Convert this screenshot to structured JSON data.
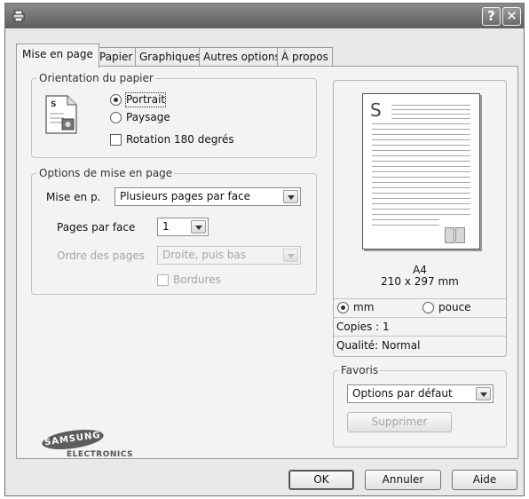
{
  "titlebar": {
    "title": "",
    "help_label": "?",
    "close_label": "✕",
    "app_icon": "printer-icon"
  },
  "tabs": [
    {
      "label": "Mise en page",
      "active": true
    },
    {
      "label": "Papier"
    },
    {
      "label": "Graphiques"
    },
    {
      "label": "Autres options"
    },
    {
      "label": "À propos"
    }
  ],
  "orientation": {
    "title": "Orientation du papier",
    "portrait": "Portrait",
    "landscape": "Paysage",
    "rotate": "Rotation 180 degrés",
    "icon": "portrait-page-icon",
    "selected": "Portrait",
    "rotate_checked": false
  },
  "layout": {
    "title": "Options de mise en page",
    "type_label": "Mise en p.",
    "type_value": "Plusieurs pages par face",
    "pages_per_side_label": "Pages par face",
    "pages_per_side_value": "1",
    "page_order_label": "Ordre des pages",
    "page_order_value": "Droite, puis bas",
    "borders_label": "Bordures"
  },
  "preview": {
    "letter": "S",
    "paper_name": "A4",
    "paper_size": "210 x 297 mm",
    "unit_mm": "mm",
    "unit_inch": "pouce",
    "unit_selected": "mm",
    "copies": "Copies : 1",
    "quality": "Qualité: Normal"
  },
  "favorites": {
    "title": "Favoris",
    "value": "Options par défaut",
    "delete_label": "Supprimer"
  },
  "logo": {
    "brand": "SAMSUNG",
    "sub": "ELECTRONICS"
  },
  "buttons": {
    "ok": "OK",
    "cancel": "Annuler",
    "help": "Aide"
  },
  "colors": {
    "titlebar": "#6f6f6f",
    "dialog_bg": "#e9e9e9",
    "panel_bg": "#f3f3f3"
  }
}
